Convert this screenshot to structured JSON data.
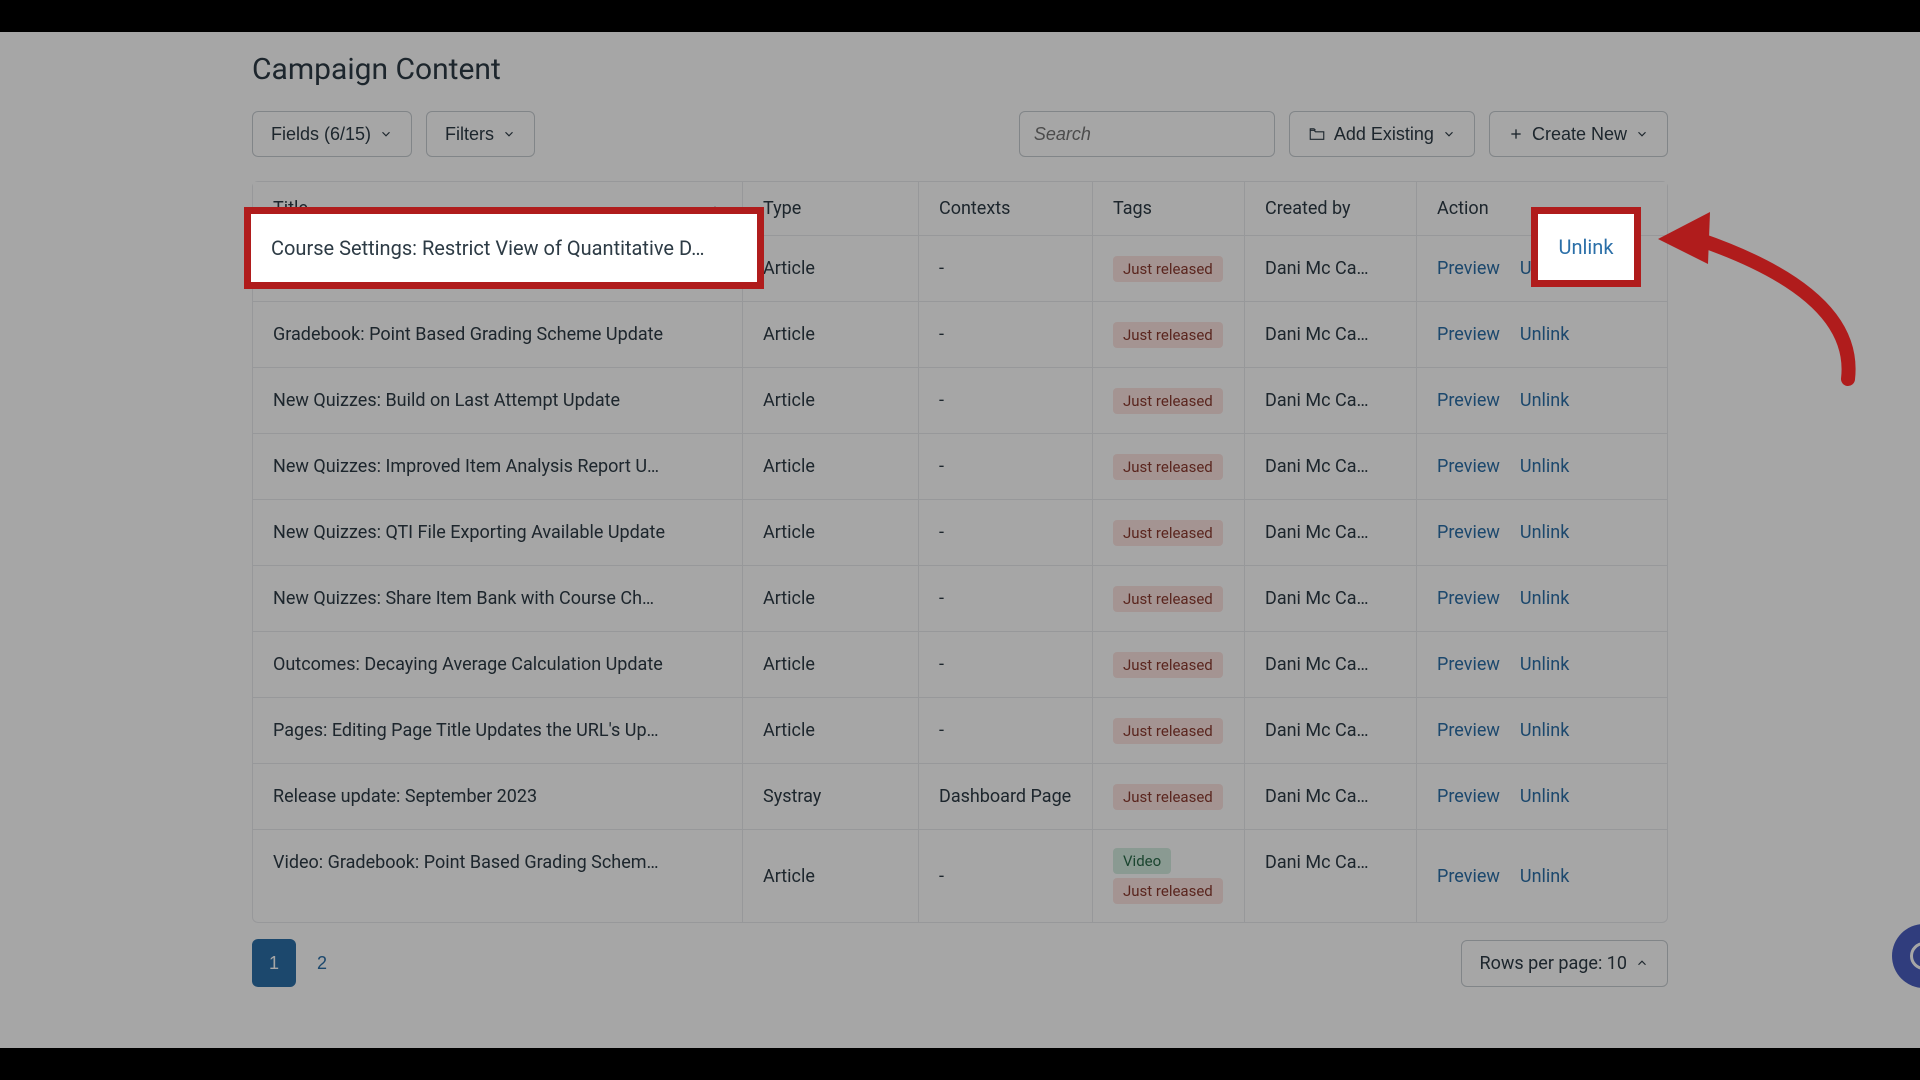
{
  "page_title": "Campaign Content",
  "toolbar": {
    "fields_label": "Fields (6/15)",
    "filters_label": "Filters",
    "search_placeholder": "Search",
    "add_existing_label": "Add Existing",
    "create_new_label": "Create New"
  },
  "columns": {
    "title": "Title",
    "type": "Type",
    "contexts": "Contexts",
    "tags": "Tags",
    "created_by": "Created by",
    "action": "Action"
  },
  "actions": {
    "preview": "Preview",
    "unlink": "Unlink"
  },
  "tags": {
    "just_released": "Just released",
    "video": "Video"
  },
  "rows": [
    {
      "title": "Course Settings: Restrict View of Quantitative D…",
      "type": "Article",
      "contexts": "-",
      "tags": [
        "just_released"
      ],
      "created_by": "Dani Mc Ca…"
    },
    {
      "title": "Gradebook: Point Based Grading Scheme Update",
      "type": "Article",
      "contexts": "-",
      "tags": [
        "just_released"
      ],
      "created_by": "Dani Mc Ca…"
    },
    {
      "title": "New Quizzes: Build on Last Attempt Update",
      "type": "Article",
      "contexts": "-",
      "tags": [
        "just_released"
      ],
      "created_by": "Dani Mc Ca…"
    },
    {
      "title": "New Quizzes: Improved Item Analysis Report U…",
      "type": "Article",
      "contexts": "-",
      "tags": [
        "just_released"
      ],
      "created_by": "Dani Mc Ca…"
    },
    {
      "title": "New Quizzes: QTI File Exporting Available Update",
      "type": "Article",
      "contexts": "-",
      "tags": [
        "just_released"
      ],
      "created_by": "Dani Mc Ca…"
    },
    {
      "title": "New Quizzes: Share Item Bank with Course Ch…",
      "type": "Article",
      "contexts": "-",
      "tags": [
        "just_released"
      ],
      "created_by": "Dani Mc Ca…"
    },
    {
      "title": "Outcomes: Decaying Average Calculation Update",
      "type": "Article",
      "contexts": "-",
      "tags": [
        "just_released"
      ],
      "created_by": "Dani Mc Ca…"
    },
    {
      "title": "Pages: Editing Page Title Updates the URL's Up…",
      "type": "Article",
      "contexts": "-",
      "tags": [
        "just_released"
      ],
      "created_by": "Dani Mc Ca…"
    },
    {
      "title": "Release update: September 2023",
      "type": "Systray",
      "contexts": "Dashboard Page",
      "tags": [
        "just_released"
      ],
      "created_by": "Dani Mc Ca…"
    },
    {
      "title": "Video: Gradebook: Point Based Grading Schem…",
      "type": "Article",
      "contexts": "-",
      "tags": [
        "video",
        "just_released"
      ],
      "created_by": "Dani Mc Ca…"
    }
  ],
  "pagination": {
    "pages": [
      "1",
      "2"
    ],
    "active": 1,
    "rows_per_page_label": "Rows per page: 10"
  },
  "highlight": {
    "title_text": "Course Settings: Restrict View of Quantitative D…",
    "unlink_text": "Unlink"
  }
}
